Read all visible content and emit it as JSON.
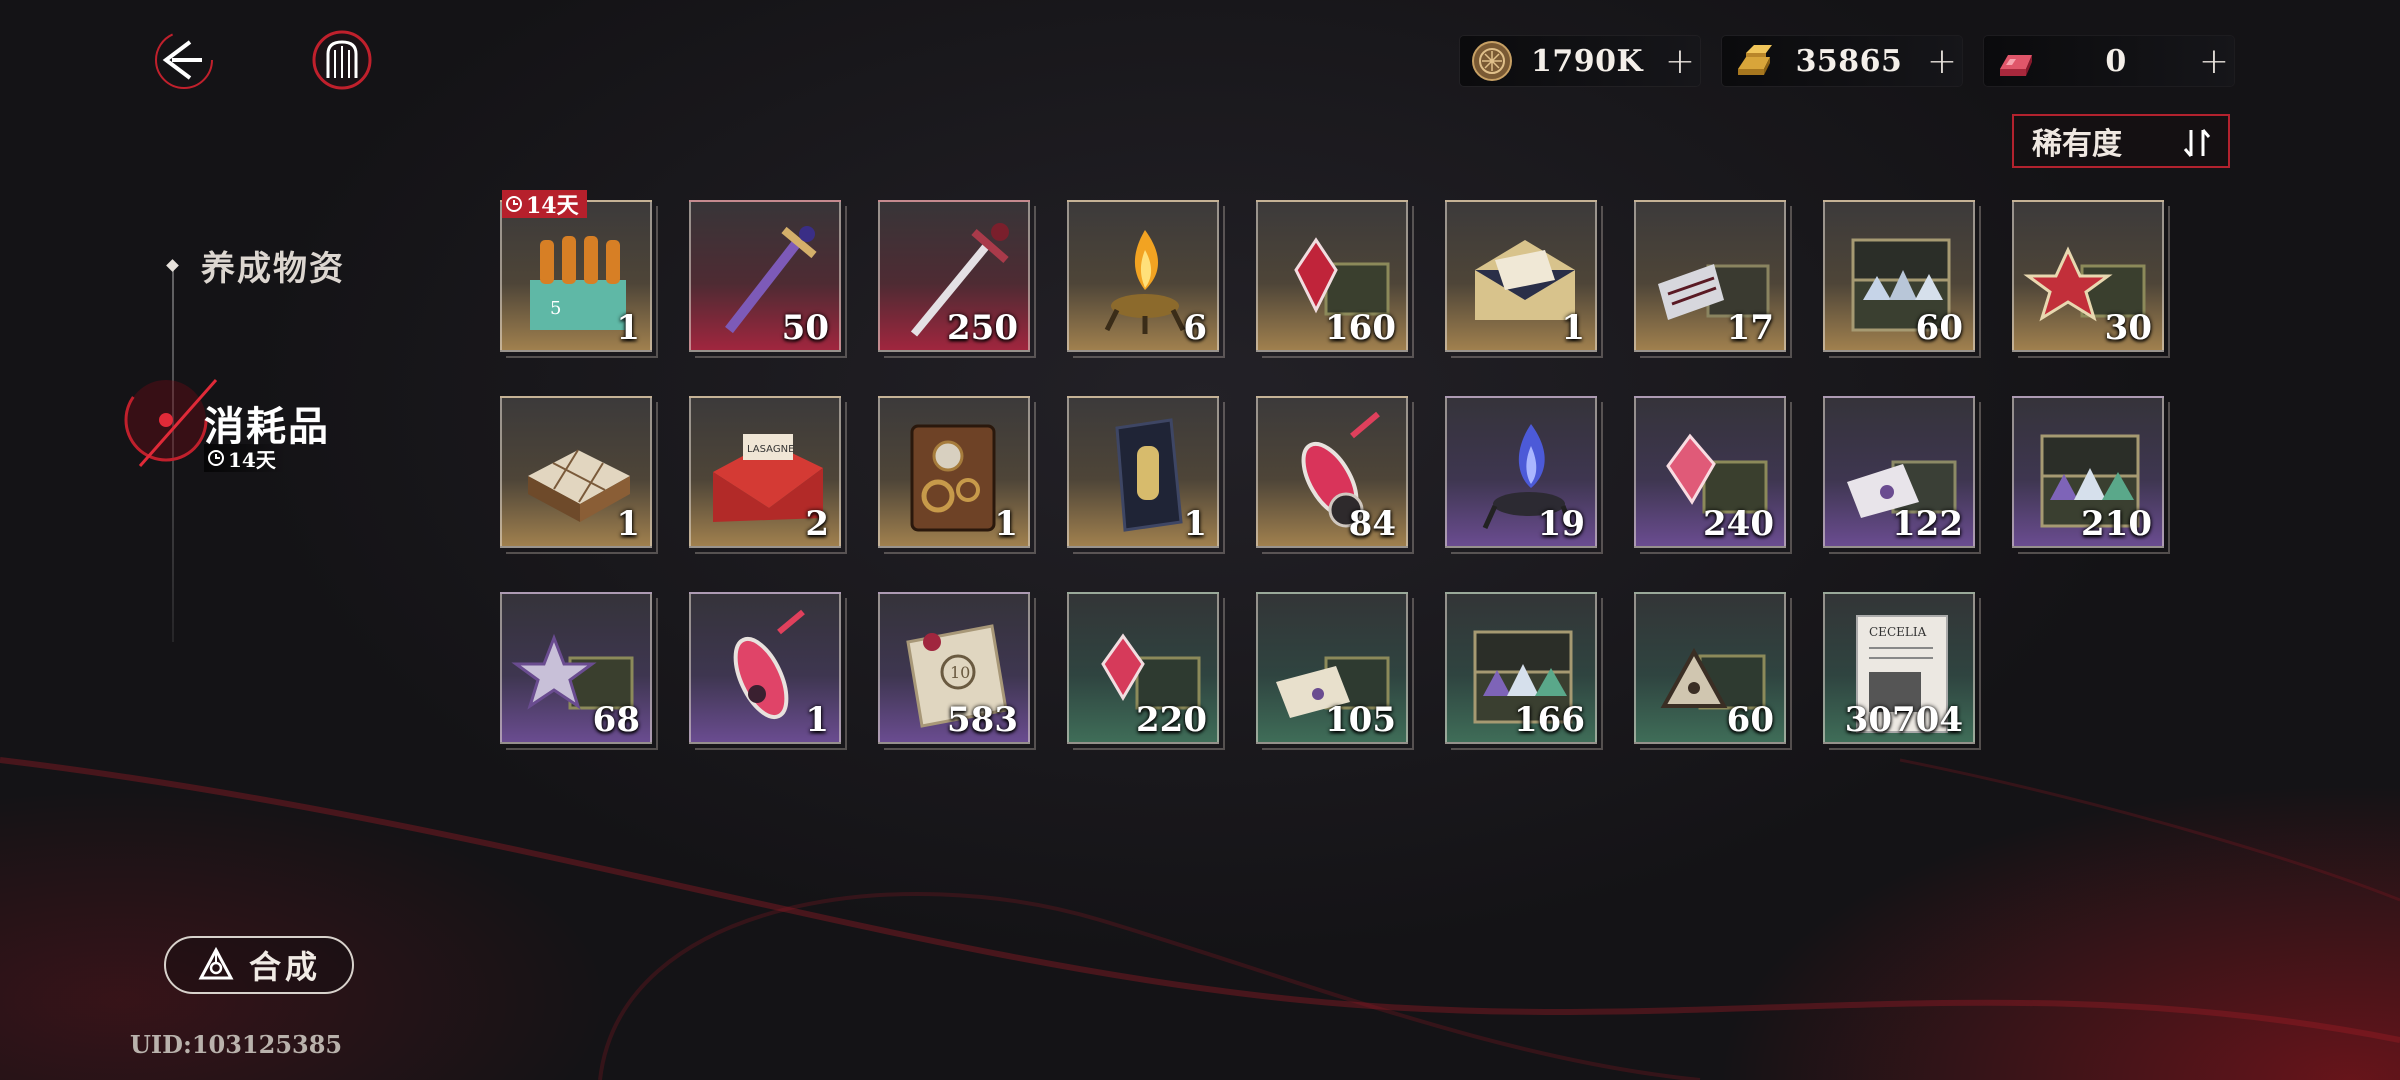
{
  "currencies": [
    {
      "name": "coins",
      "icon": "coin-icon",
      "value": "1790K"
    },
    {
      "name": "gold",
      "icon": "gold-bar-icon",
      "value": "35865"
    },
    {
      "name": "crystal",
      "icon": "red-bar-icon",
      "value": "0"
    }
  ],
  "sort": {
    "label": "稀有度"
  },
  "nav": {
    "materials": "养成物资",
    "consumables": "消耗品",
    "consumables_timer": "14天"
  },
  "synth": {
    "label": "合成"
  },
  "uid": "UID:103125385",
  "items": [
    {
      "quantity": "1",
      "rarity": "gold",
      "art": "soda-crate-icon",
      "badge": "14天"
    },
    {
      "quantity": "50",
      "rarity": "red",
      "art": "ornate-dagger-icon"
    },
    {
      "quantity": "250",
      "rarity": "red",
      "art": "silver-dagger-icon"
    },
    {
      "quantity": "6",
      "rarity": "gold",
      "art": "flame-lamp-icon"
    },
    {
      "quantity": "160",
      "rarity": "gold",
      "art": "red-crystal-case-icon"
    },
    {
      "quantity": "1",
      "rarity": "gold",
      "art": "letter-envelope-icon"
    },
    {
      "quantity": "17",
      "rarity": "gold",
      "art": "document-case-icon"
    },
    {
      "quantity": "60",
      "rarity": "gold",
      "art": "crystal-chest-icon"
    },
    {
      "quantity": "30",
      "rarity": "gold",
      "art": "badge-case-icon"
    },
    {
      "quantity": "1",
      "rarity": "gold",
      "art": "chessboard-icon"
    },
    {
      "quantity": "2",
      "rarity": "gold",
      "art": "red-envelope-icon"
    },
    {
      "quantity": "1",
      "rarity": "gold",
      "art": "clockwork-book-icon"
    },
    {
      "quantity": "1",
      "rarity": "gold",
      "art": "bottle-box-icon"
    },
    {
      "quantity": "84",
      "rarity": "gold",
      "art": "red-potion-icon"
    },
    {
      "quantity": "19",
      "rarity": "purple",
      "art": "blue-flame-lamp-icon"
    },
    {
      "quantity": "240",
      "rarity": "purple",
      "art": "pink-crystal-case-icon"
    },
    {
      "quantity": "122",
      "rarity": "purple",
      "art": "letter-case-icon"
    },
    {
      "quantity": "210",
      "rarity": "purple",
      "art": "gem-chest-icon"
    },
    {
      "quantity": "68",
      "rarity": "purple",
      "art": "star-badge-case-icon"
    },
    {
      "quantity": "1",
      "rarity": "purple",
      "art": "pink-potion-icon"
    },
    {
      "quantity": "583",
      "rarity": "purple",
      "art": "sealed-letter-icon"
    },
    {
      "quantity": "220",
      "rarity": "green",
      "art": "crystal-case-icon"
    },
    {
      "quantity": "105",
      "rarity": "green",
      "art": "envelope-case-icon"
    },
    {
      "quantity": "166",
      "rarity": "green",
      "art": "gem-chest-icon"
    },
    {
      "quantity": "60",
      "rarity": "green",
      "art": "triangle-case-icon"
    },
    {
      "quantity": "30704",
      "rarity": "green",
      "art": "dossier-icon"
    }
  ],
  "colors": {
    "accent_red": "#b6202c",
    "gold_rarity": "#a0804e",
    "red_rarity": "#a0263e",
    "purple_rarity": "#6a4c90",
    "green_rarity": "#3f6d58"
  }
}
